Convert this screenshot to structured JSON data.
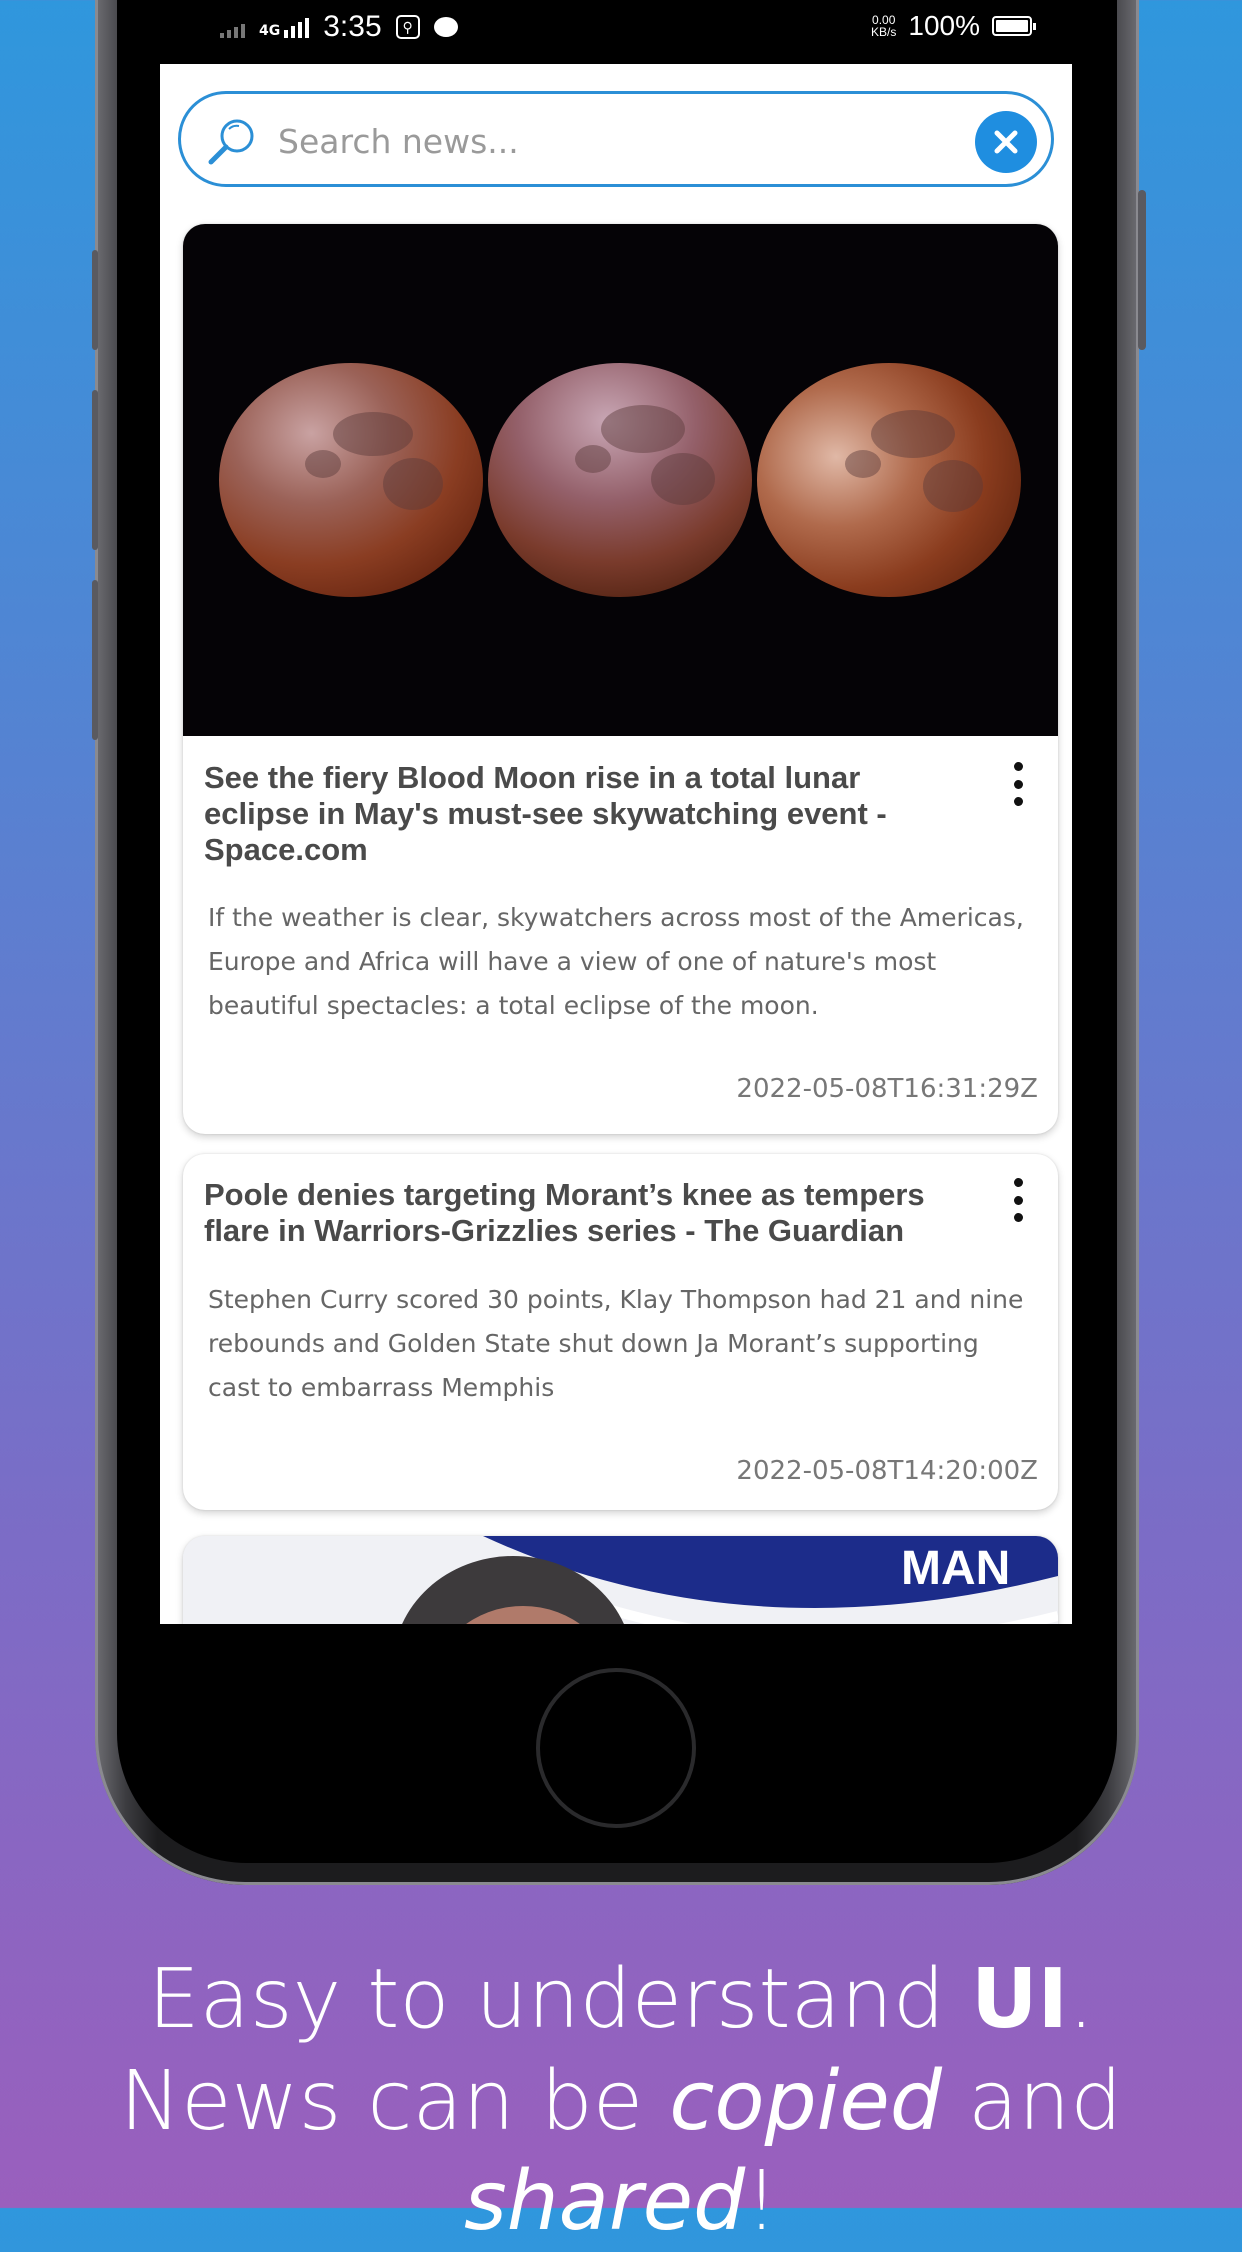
{
  "status_bar": {
    "network": "4G",
    "time": "3:35",
    "speed_value": "0.00",
    "speed_unit": "KB/s",
    "battery": "100%"
  },
  "search": {
    "placeholder": "Search news..."
  },
  "articles": [
    {
      "title": "See the fiery Blood Moon rise in a total lunar eclipse in May's must-see skywatching event - Space.com",
      "description": "If the weather is clear, skywatchers across most of the Americas, Europe and Africa will have a view of one of nature's most beautiful spectacles: a total eclipse of the moon.",
      "date": "2022-05-08T16:31:29Z"
    },
    {
      "title": "Poole denies targeting Morant’s knee as tempers flare in Warriors-Grizzlies series - The Guardian",
      "description": "Stephen Curry scored 30 points, Klay Thompson had 21 and nine rebounds and Golden State shut down Ja Morant’s supporting cast to embarrass Memphis",
      "date": "2022-05-08T14:20:00Z"
    },
    {
      "image_text": "MAN"
    }
  ],
  "caption": {
    "line1_prefix": "Easy to understand ",
    "line1_bold": "UI",
    "line1_suffix": ".",
    "line2_a": "News can be ",
    "line2_italic1": "copied",
    "line2_b": " and ",
    "line2_italic2": "shared",
    "line2_end": "!"
  }
}
